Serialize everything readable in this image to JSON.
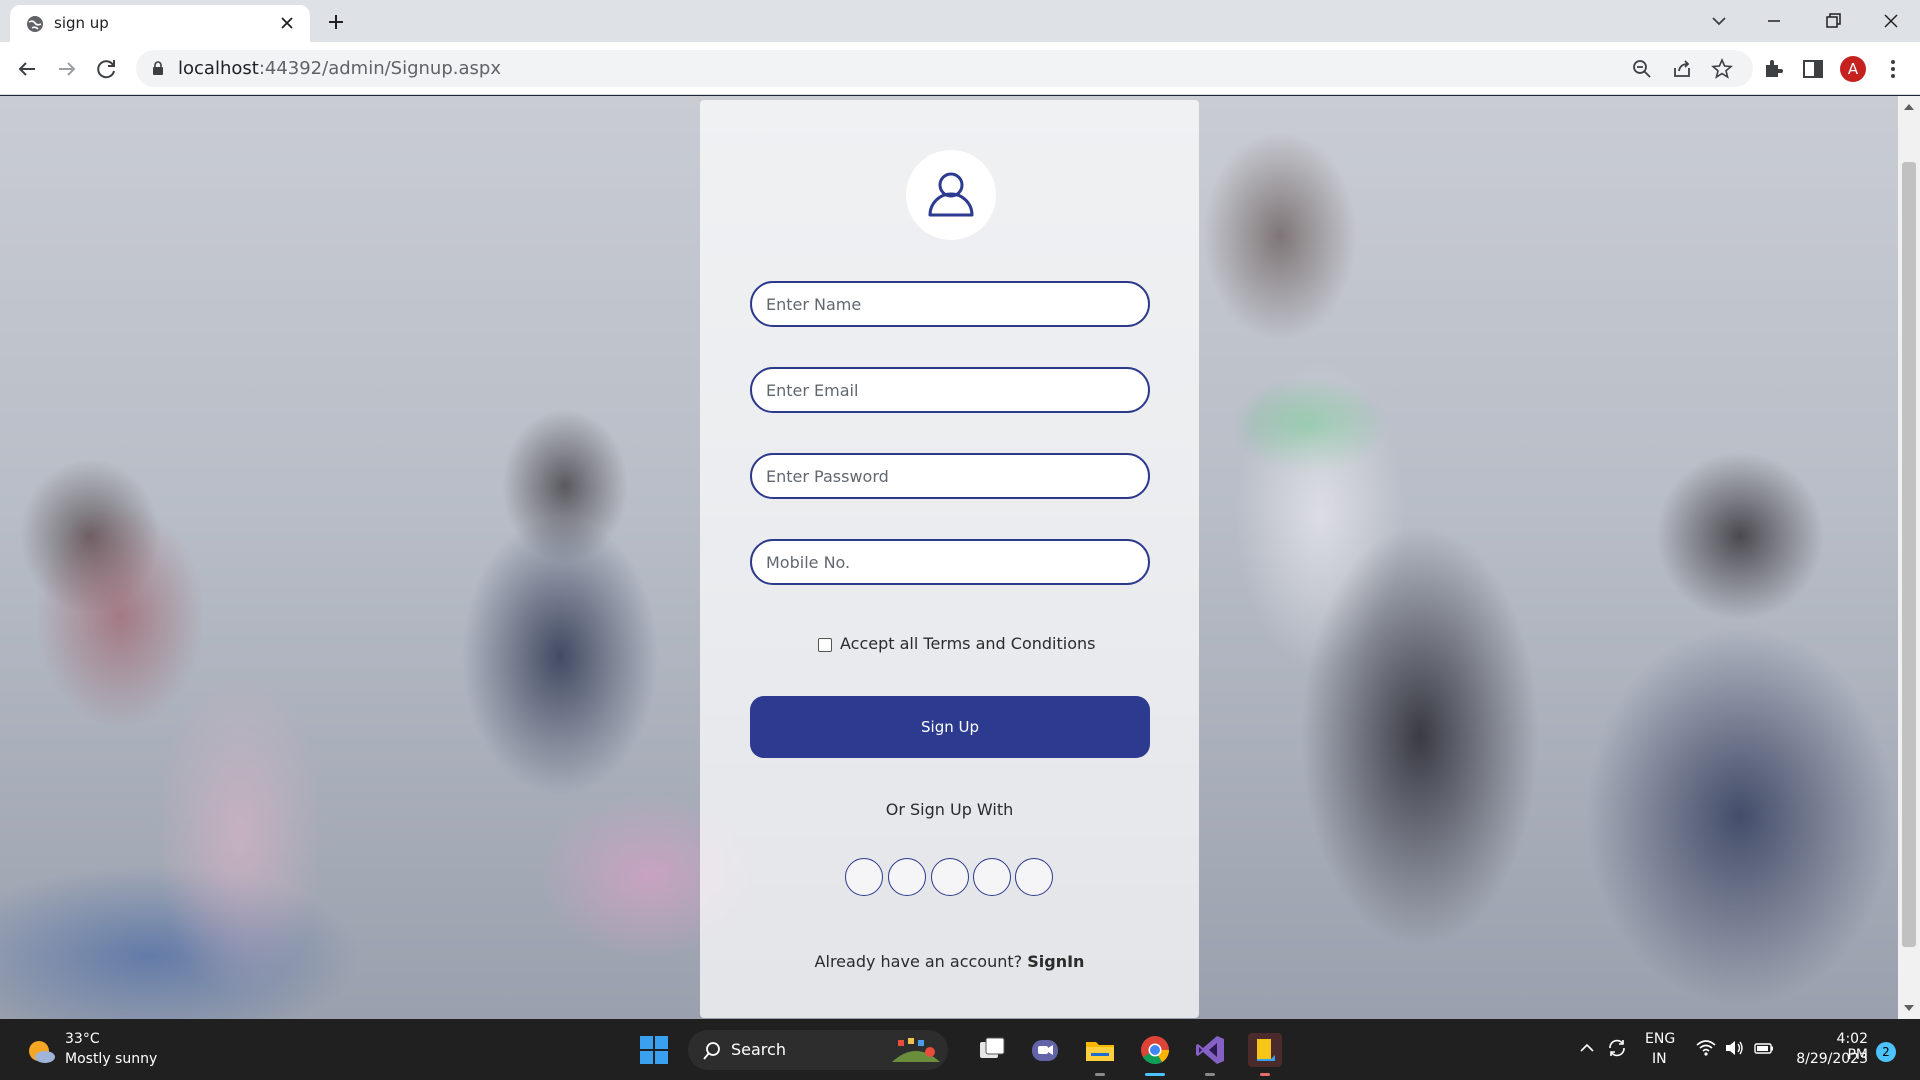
{
  "browser": {
    "tab_title": "sign up",
    "url_host": "localhost",
    "url_rest": ":44392/admin/Signup.aspx",
    "profile_initial": "A"
  },
  "form": {
    "name_placeholder": "Enter Name",
    "email_placeholder": "Enter Email",
    "password_placeholder": "Enter Password",
    "mobile_placeholder": "Mobile No.",
    "terms_label": "Accept all Terms and Conditions",
    "terms_checked": false,
    "signup_label": "Sign Up",
    "or_text": "Or Sign Up With",
    "social_buttons": [
      "",
      "",
      "",
      "",
      ""
    ],
    "account_prompt": "Already have an account?",
    "signin_label": "SignIn"
  },
  "taskbar": {
    "temperature": "33°C",
    "weather": "Mostly sunny",
    "search_label": "Search",
    "lang_1": "ENG",
    "lang_2": "IN",
    "time": "4:02 PM",
    "date": "8/29/2023",
    "notification_count": "2"
  },
  "colors": {
    "accent": "#2c3a8f",
    "taskbar": "#202020",
    "profile": "#c5221f"
  }
}
